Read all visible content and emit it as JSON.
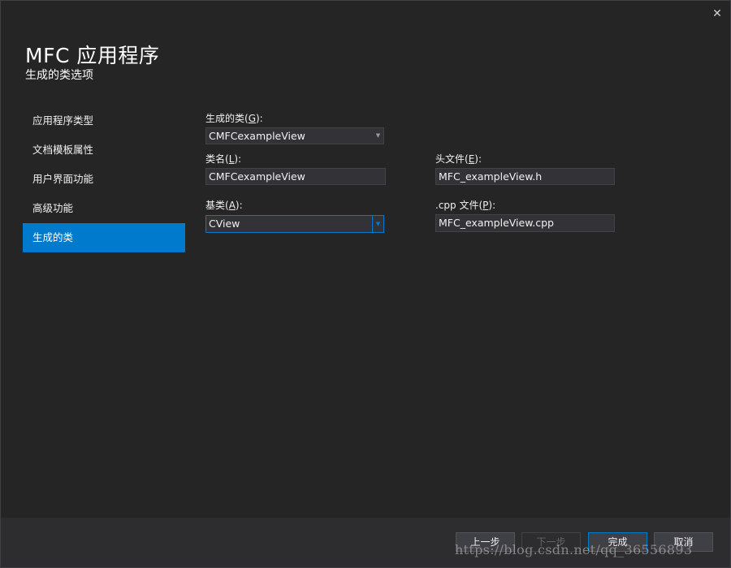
{
  "window": {
    "close_glyph": "✕",
    "title": "MFC 应用程序",
    "subtitle": "生成的类选项"
  },
  "nav": {
    "items": [
      {
        "label": "应用程序类型",
        "active": false
      },
      {
        "label": "文档模板属性",
        "active": false
      },
      {
        "label": "用户界面功能",
        "active": false
      },
      {
        "label": "高级功能",
        "active": false
      },
      {
        "label": "生成的类",
        "active": true
      }
    ]
  },
  "form": {
    "generated_class": {
      "label_pre": "生成的类(",
      "access_key": "G",
      "label_post": "):",
      "value": "CMFCexampleView"
    },
    "class_name": {
      "label_pre": "类名(",
      "access_key": "L",
      "label_post": "):",
      "value": "CMFCexampleView"
    },
    "base_class": {
      "label_pre": "基类(",
      "access_key": "A",
      "label_post": "):",
      "value": "CView"
    },
    "header_file": {
      "label_pre": "头文件(",
      "access_key": "E",
      "label_post": "):",
      "value": "MFC_exampleView.h"
    },
    "cpp_file": {
      "label_pre": ".cpp 文件(",
      "access_key": "P",
      "label_post": "):",
      "value": "MFC_exampleView.cpp"
    }
  },
  "buttons": {
    "prev": "上一步",
    "next": "下一步",
    "finish": "完成",
    "cancel": "取消"
  },
  "watermark": "https://blog.csdn.net/qq_36556893",
  "colors": {
    "background": "#252526",
    "accent": "#007acc",
    "field_bg": "#333337",
    "bottom_bar": "#2d2d30"
  }
}
